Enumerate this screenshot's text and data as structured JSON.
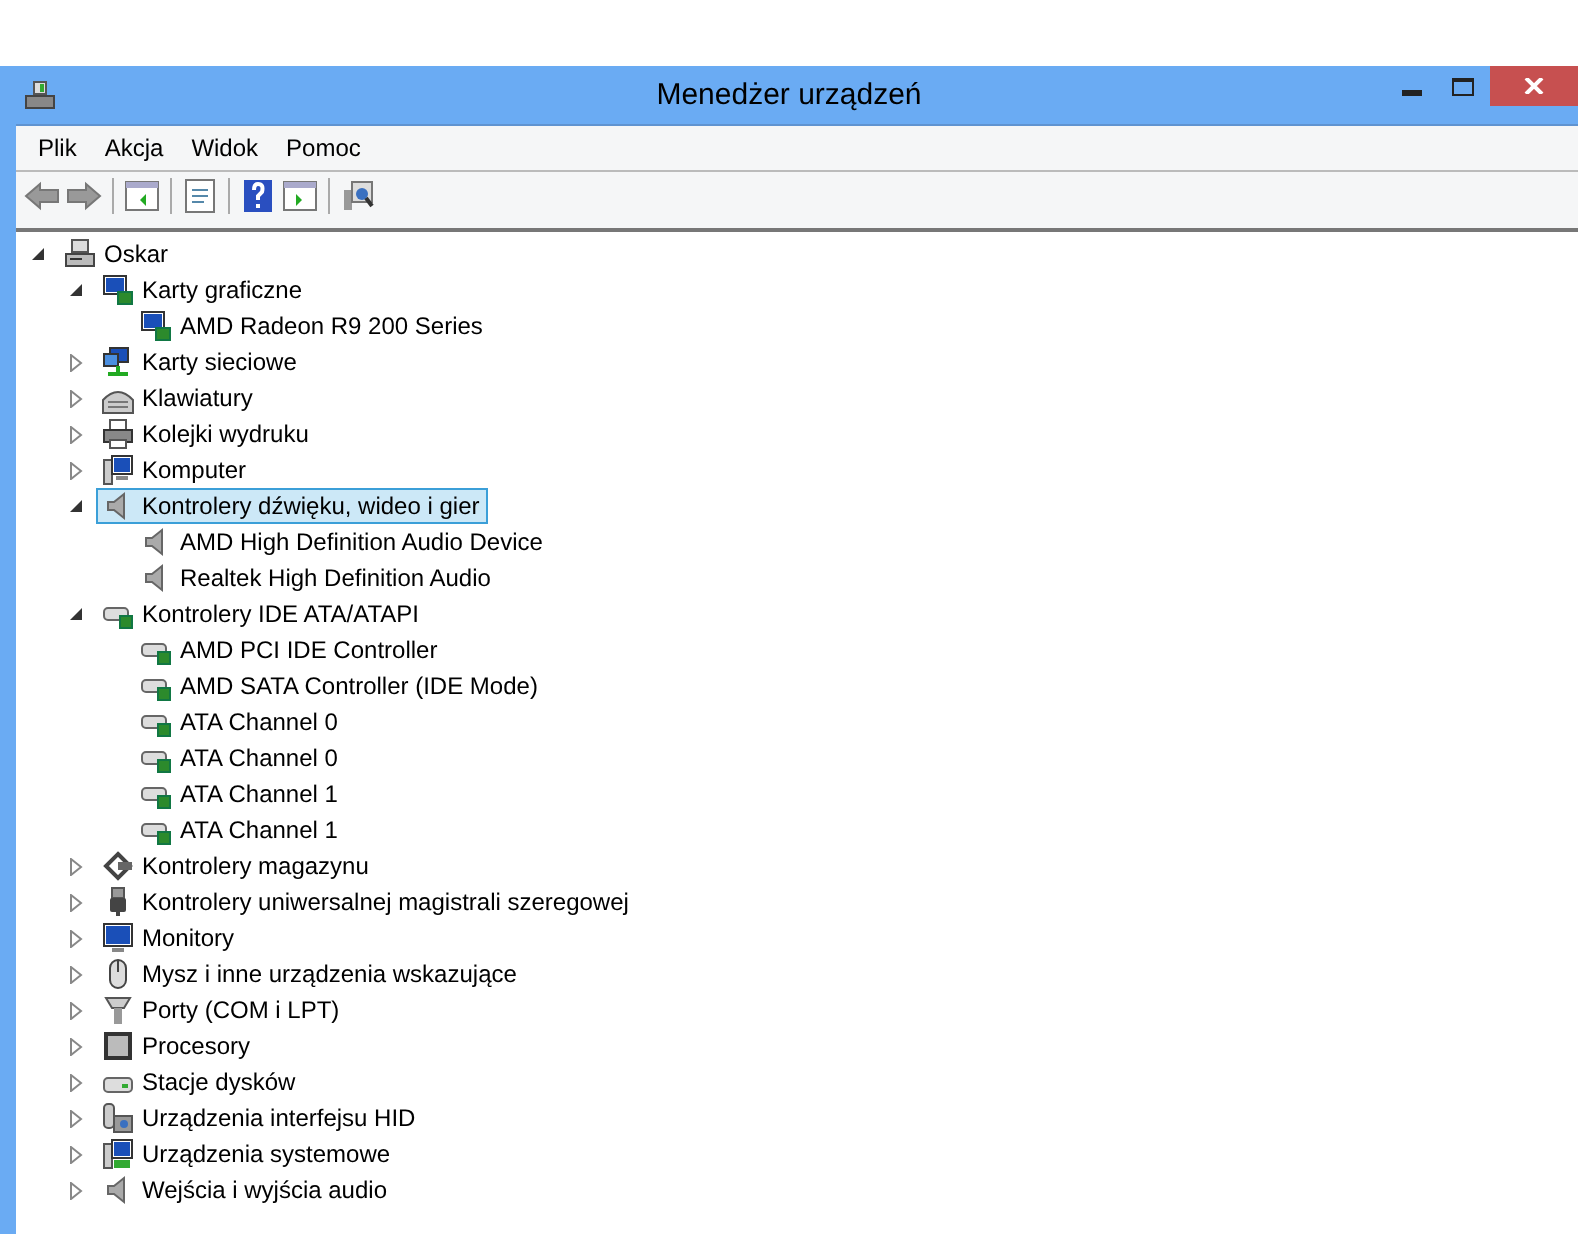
{
  "window": {
    "title": "Menedżer urządzeń"
  },
  "menu": [
    {
      "label": "Plik"
    },
    {
      "label": "Akcja"
    },
    {
      "label": "Widok"
    },
    {
      "label": "Pomoc"
    }
  ],
  "tree": [
    {
      "label": "Oskar",
      "kind": "computer",
      "expanded": true,
      "selected": false,
      "children": [
        {
          "label": "Karty graficzne",
          "kind": "display",
          "expanded": true,
          "selected": false,
          "children": [
            {
              "label": "AMD Radeon R9 200 Series",
              "kind": "display",
              "selected": false
            }
          ]
        },
        {
          "label": "Karty sieciowe",
          "kind": "network",
          "expanded": false,
          "selected": false
        },
        {
          "label": "Klawiatury",
          "kind": "keyboard",
          "expanded": false,
          "selected": false
        },
        {
          "label": "Kolejki wydruku",
          "kind": "printer",
          "expanded": false,
          "selected": false
        },
        {
          "label": "Komputer",
          "kind": "pc",
          "expanded": false,
          "selected": false
        },
        {
          "label": "Kontrolery dźwięku, wideo i gier",
          "kind": "speaker",
          "expanded": true,
          "selected": true,
          "children": [
            {
              "label": "AMD High Definition Audio Device",
              "kind": "speaker",
              "selected": false
            },
            {
              "label": "Realtek High Definition Audio",
              "kind": "speaker",
              "selected": false
            }
          ]
        },
        {
          "label": "Kontrolery IDE ATA/ATAPI",
          "kind": "ide",
          "expanded": true,
          "selected": false,
          "children": [
            {
              "label": "AMD PCI IDE Controller",
              "kind": "ide",
              "selected": false
            },
            {
              "label": "AMD SATA Controller (IDE Mode)",
              "kind": "ide",
              "selected": false
            },
            {
              "label": "ATA Channel 0",
              "kind": "ide",
              "selected": false
            },
            {
              "label": "ATA Channel 0",
              "kind": "ide",
              "selected": false
            },
            {
              "label": "ATA Channel 1",
              "kind": "ide",
              "selected": false
            },
            {
              "label": "ATA Channel 1",
              "kind": "ide",
              "selected": false
            }
          ]
        },
        {
          "label": "Kontrolery magazynu",
          "kind": "storage",
          "expanded": false,
          "selected": false
        },
        {
          "label": "Kontrolery uniwersalnej magistrali szeregowej",
          "kind": "usb",
          "expanded": false,
          "selected": false
        },
        {
          "label": "Monitory",
          "kind": "monitor",
          "expanded": false,
          "selected": false
        },
        {
          "label": "Mysz i inne urządzenia wskazujące",
          "kind": "mouse",
          "expanded": false,
          "selected": false
        },
        {
          "label": "Porty (COM i LPT)",
          "kind": "port",
          "expanded": false,
          "selected": false
        },
        {
          "label": "Procesory",
          "kind": "cpu",
          "expanded": false,
          "selected": false
        },
        {
          "label": "Stacje dysków",
          "kind": "disk",
          "expanded": false,
          "selected": false
        },
        {
          "label": "Urządzenia interfejsu HID",
          "kind": "hid",
          "expanded": false,
          "selected": false
        },
        {
          "label": "Urządzenia systemowe",
          "kind": "system",
          "expanded": false,
          "selected": false
        },
        {
          "label": "Wejścia i wyjścia audio",
          "kind": "speaker",
          "expanded": false,
          "selected": false
        }
      ]
    }
  ]
}
